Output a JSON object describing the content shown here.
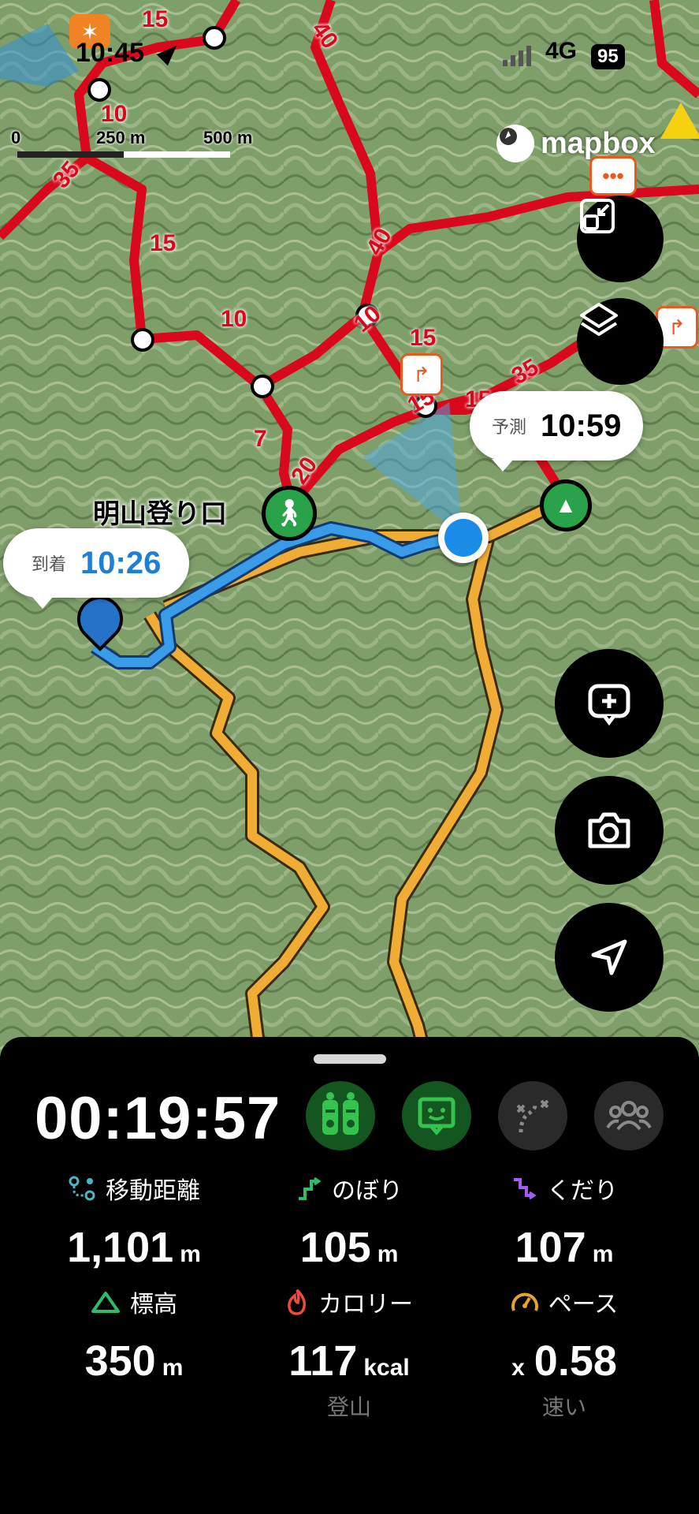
{
  "status_bar": {
    "time": "10:45",
    "network": "4G",
    "battery": "95"
  },
  "map": {
    "scale": {
      "zero": "0",
      "mid": "250 m",
      "end": "500 m"
    },
    "attribution": "mapbox",
    "place_label": "明山登り口",
    "arrival": {
      "label": "到着",
      "time": "10:26"
    },
    "forecast": {
      "label": "予測",
      "time": "10:59"
    },
    "route_times": [
      "15",
      "40",
      "10",
      "35",
      "15",
      "10",
      "40",
      "10",
      "15",
      "15",
      "7",
      "20",
      "15",
      "35",
      "15"
    ],
    "colors": {
      "trail": "#d9081c",
      "track": "#2b8be8",
      "road": "#f0ad36",
      "accent_green": "#2aa24a"
    }
  },
  "map_controls": [
    {
      "icon": "fit-icon"
    },
    {
      "icon": "layers-icon"
    },
    {
      "icon": "add-comment-icon"
    },
    {
      "icon": "camera-icon"
    },
    {
      "icon": "location-arrow-icon"
    }
  ],
  "panel": {
    "timer": "00:19:57",
    "buttons": [
      {
        "icon": "hikers-icon",
        "active": true
      },
      {
        "icon": "message-icon",
        "active": true
      },
      {
        "icon": "route-icon",
        "active": false
      },
      {
        "icon": "group-icon",
        "active": false
      }
    ],
    "stats": {
      "distance": {
        "label": "移動距離",
        "value": "1,101",
        "unit": "m"
      },
      "ascent": {
        "label": "のぼり",
        "value": "105",
        "unit": "m"
      },
      "descent": {
        "label": "くだり",
        "value": "107",
        "unit": "m"
      },
      "elevation": {
        "label": "標高",
        "value": "350",
        "unit": "m"
      },
      "calories": {
        "label": "カロリー",
        "value": "117",
        "unit": "kcal",
        "sub": "登山"
      },
      "pace": {
        "label": "ペース",
        "prefix": "x",
        "value": "0.58",
        "sub": "速い"
      }
    }
  }
}
